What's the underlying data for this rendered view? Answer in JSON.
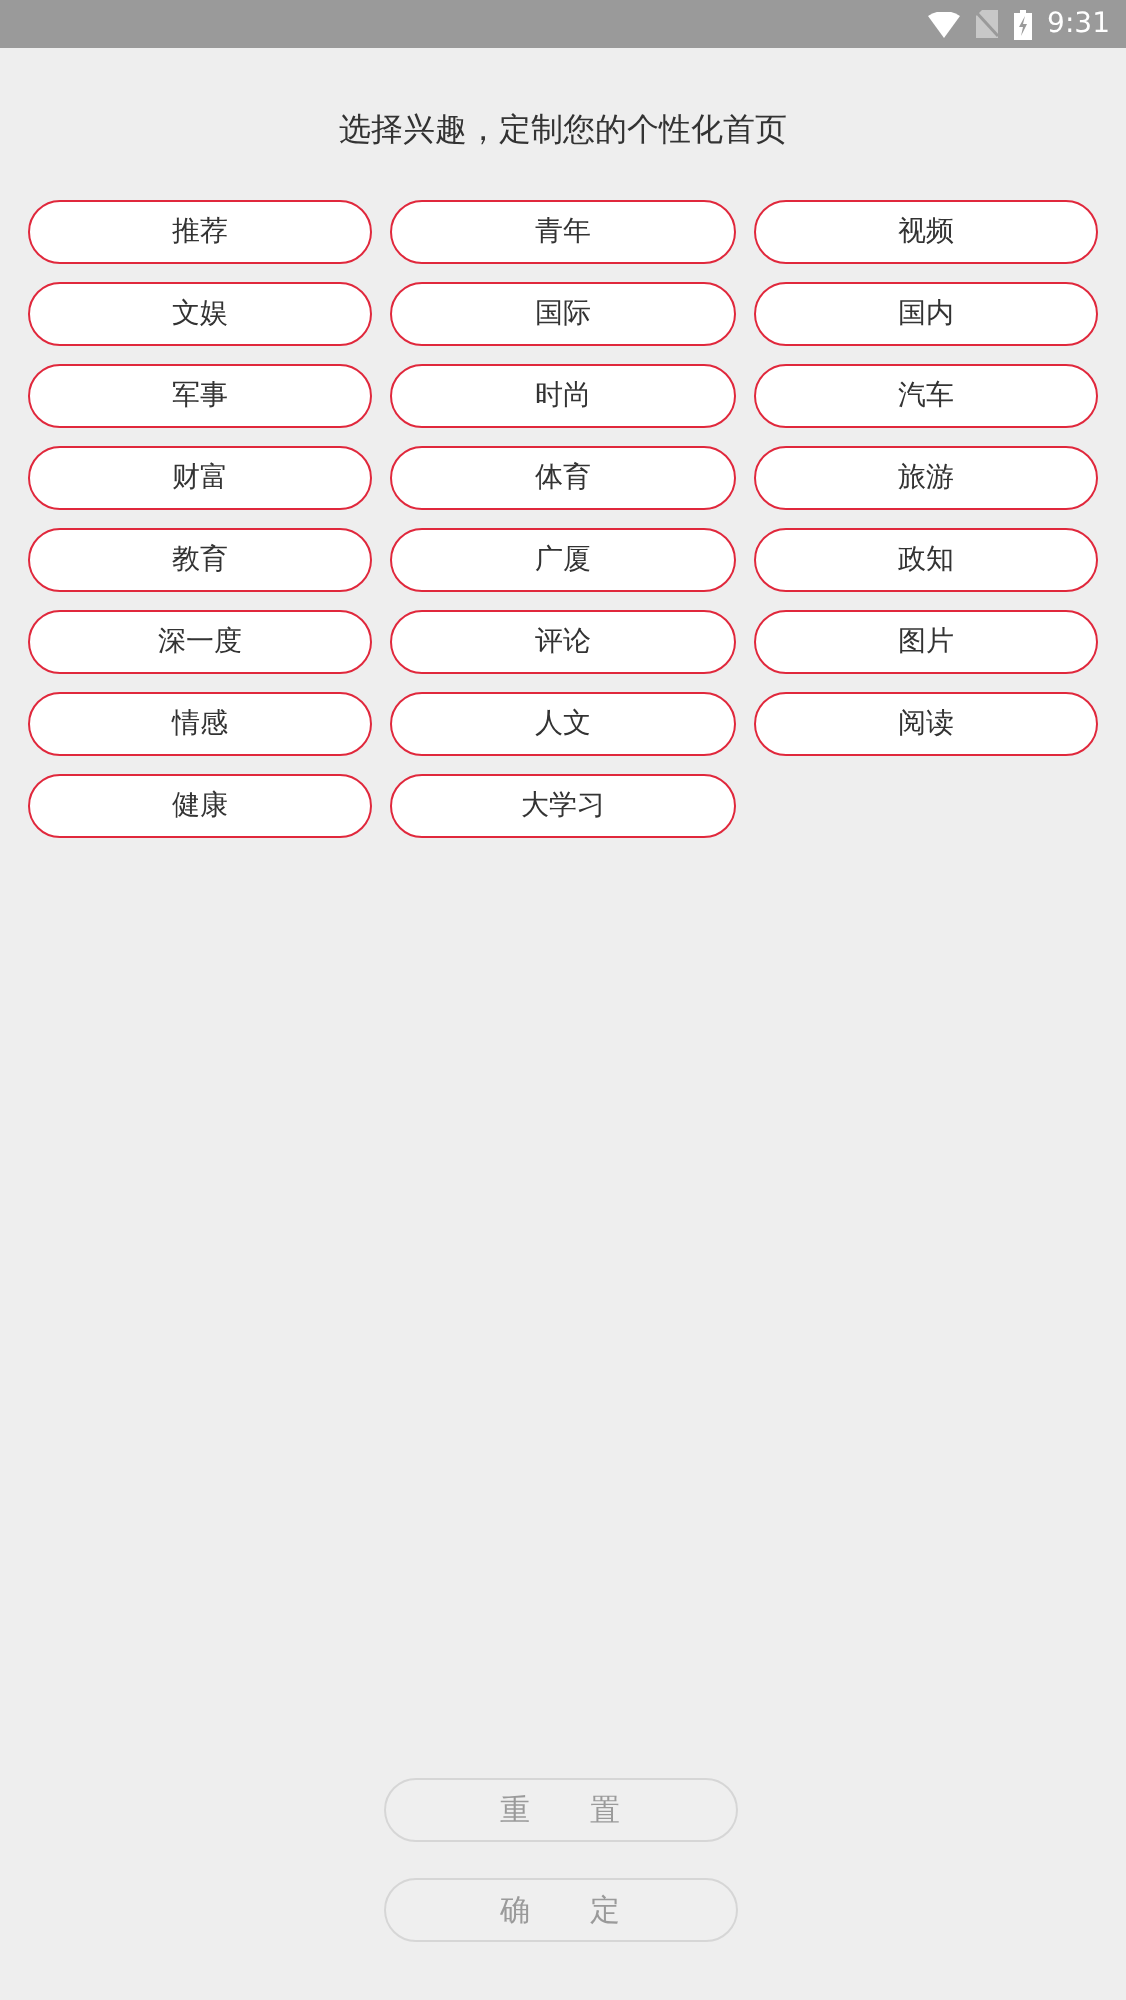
{
  "status_bar": {
    "time": "9:31"
  },
  "title": "选择兴趣，定制您的个性化首页",
  "tags": [
    {
      "label": "推荐",
      "selected": false
    },
    {
      "label": "青年",
      "selected": false
    },
    {
      "label": "视频",
      "selected": false
    },
    {
      "label": "文娱",
      "selected": false
    },
    {
      "label": "国际",
      "selected": false
    },
    {
      "label": "国内",
      "selected": false
    },
    {
      "label": "军事",
      "selected": false
    },
    {
      "label": "时尚",
      "selected": false
    },
    {
      "label": "汽车",
      "selected": false
    },
    {
      "label": "财富",
      "selected": false
    },
    {
      "label": "体育",
      "selected": false
    },
    {
      "label": "旅游",
      "selected": false
    },
    {
      "label": "教育",
      "selected": false
    },
    {
      "label": "广厦",
      "selected": false
    },
    {
      "label": "政知",
      "selected": false
    },
    {
      "label": "深一度",
      "selected": false
    },
    {
      "label": "评论",
      "selected": false
    },
    {
      "label": "图片",
      "selected": false
    },
    {
      "label": "情感",
      "selected": false
    },
    {
      "label": "人文",
      "selected": false
    },
    {
      "label": "阅读",
      "selected": false
    },
    {
      "label": "健康",
      "selected": false
    },
    {
      "label": "大学习",
      "selected": false
    }
  ],
  "buttons": [
    {
      "label": "重　　置",
      "disabled": true
    },
    {
      "label": "确　　定",
      "disabled": true
    }
  ]
}
